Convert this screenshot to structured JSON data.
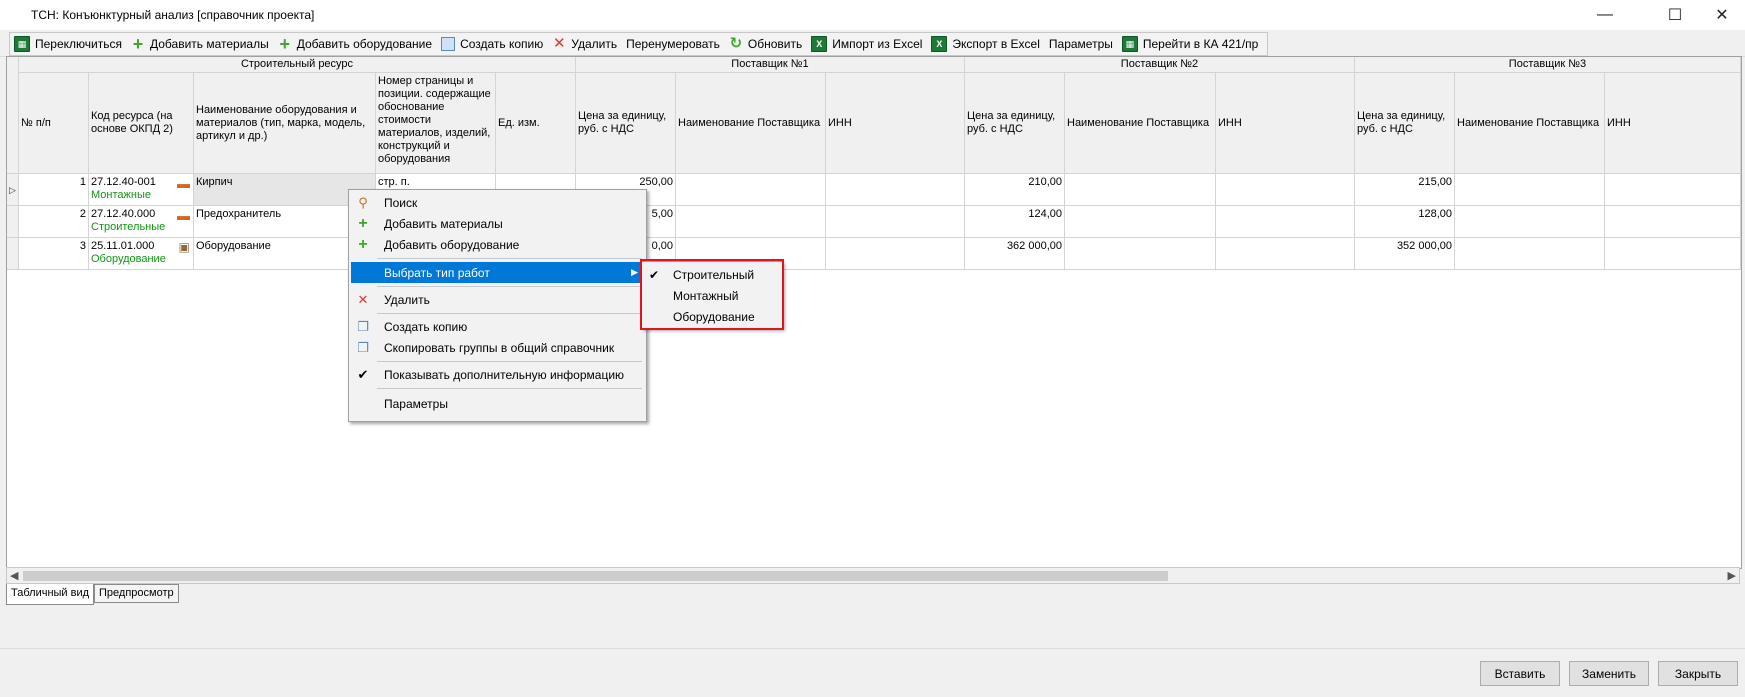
{
  "window": {
    "title": "ТСН: Конъюнктурный анализ [справочник проекта]",
    "minimize": "—",
    "maximize": "☐",
    "close": "✕"
  },
  "toolbar": {
    "items": [
      {
        "label": "Переключиться",
        "icon": "excel-sheet-icon"
      },
      {
        "label": "Добавить материалы",
        "icon": "plus-icon"
      },
      {
        "label": "Добавить оборудование",
        "icon": "plus-icon"
      },
      {
        "label": "Создать копию",
        "icon": "copy-icon"
      },
      {
        "label": "Удалить",
        "icon": "x-icon"
      },
      {
        "label": "Перенумеровать",
        "icon": ""
      },
      {
        "label": "Обновить",
        "icon": "refresh-icon"
      },
      {
        "label": "Импорт из Excel",
        "icon": "excel-icon"
      },
      {
        "label": "Экспорт в Excel",
        "icon": "excel-icon"
      },
      {
        "label": "Параметры",
        "icon": ""
      },
      {
        "label": "Перейти в КА 421/пр",
        "icon": "excel-sheet-icon"
      }
    ]
  },
  "grid": {
    "group_headers": {
      "resource": "Строительный ресурс",
      "supplier1": "Поставщик №1",
      "supplier2": "Поставщик №2",
      "supplier3": "Поставщик №3"
    },
    "columns": {
      "num": "№ п/п",
      "code": "Код ресурса (на основе ОКПД 2)",
      "name": "Наименование оборудования и материалов (тип, марка, модель, артикул и др.)",
      "page": "Номер страницы и позиции. содержащие обоснование стоимости материалов, изделий, конструкций и оборудования",
      "unit": "Ед. изм.",
      "price": "Цена за единицу, руб. с НДС",
      "supplier_name": "Наименование Поставщика",
      "inn": "ИНН"
    },
    "rows": [
      {
        "num": "1",
        "code": "27.12.40-001",
        "type": "Монтажные",
        "name": "Кирпич",
        "page": "стр. п.",
        "p1": "250,00",
        "p2": "210,00",
        "p3": "215,00"
      },
      {
        "num": "2",
        "code": "27.12.40.000",
        "type": "Строительные",
        "name": "Предохранитель",
        "page": "",
        "p1": "5,00",
        "p2": "124,00",
        "p3": "128,00"
      },
      {
        "num": "3",
        "code": "25.11.01.000",
        "type": "Оборудование",
        "name": "Оборудование",
        "page": "",
        "p1": "0,00",
        "p2": "362 000,00",
        "p3": "352 000,00"
      }
    ]
  },
  "tabs": {
    "table": "Табличный вид",
    "preview": "Предпросмотр"
  },
  "buttons": {
    "insert": "Вставить",
    "replace": "Заменить",
    "close": "Закрыть"
  },
  "context_menu": {
    "search": "Поиск",
    "add_materials": "Добавить материалы",
    "add_equipment": "Добавить оборудование",
    "choose_work_type": "Выбрать тип работ",
    "delete": "Удалить",
    "create_copy": "Создать копию",
    "copy_groups": "Скопировать группы в общий справочник",
    "show_extra_info": "Показывать дополнительную информацию",
    "parameters": "Параметры"
  },
  "submenu": {
    "items": [
      {
        "label": "Строительный",
        "checked": true
      },
      {
        "label": "Монтажный",
        "checked": false
      },
      {
        "label": "Оборудование",
        "checked": false
      }
    ]
  },
  "colors": {
    "highlight": "#0078d7",
    "work_type_green": "#129613",
    "annotation_red": "#e4141c"
  }
}
